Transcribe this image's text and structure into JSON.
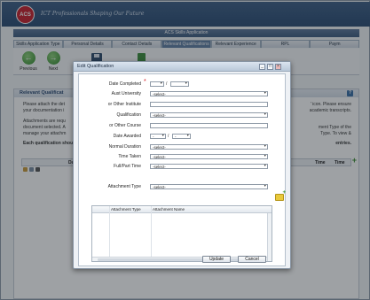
{
  "app": {
    "logo_text": "ACS",
    "tagline": "ICT Professionals Shaping Our Future",
    "window_title": "ACS Skills Application"
  },
  "tabs": [
    {
      "label": "Skills Application Type",
      "active": false
    },
    {
      "label": "Personal Details",
      "active": false
    },
    {
      "label": "Contact Details",
      "active": false
    },
    {
      "label": "Relevant Qualifications",
      "active": true
    },
    {
      "label": "Relevant Experience",
      "active": false
    },
    {
      "label": "RPL",
      "active": false
    },
    {
      "label": "Paym",
      "active": false
    }
  ],
  "toolbar": {
    "previous_label": "Previous",
    "next_label": "Next"
  },
  "section": {
    "title": "Relevant Qualificat",
    "line1": "Please attach the det",
    "line2": "your documentation i",
    "line3": "Attachments are requ",
    "line4": "document selected. A",
    "line5": "manage your attachm",
    "line6": "Each qualification shoul",
    "right1": "' icon. Please ensure",
    "right2": "academic transcripts.",
    "right3": "ment Type of the",
    "right4": "Type. To view &",
    "right5": "entries.",
    "grid_col_date": "Date C",
    "grid_col_time1": "Time",
    "grid_col_time2": "Time"
  },
  "dialog": {
    "title": "Edit Qualification",
    "fields": {
      "date_completed_label": "Date Completed",
      "date_completed_day": "",
      "date_completed_month": "",
      "aust_university_label": "Aust University",
      "aust_university_value": "-select-",
      "other_institute_label": "or Other Institute",
      "other_institute_value": "",
      "qualification_label": "Qualification",
      "qualification_value": "-select-",
      "other_course_label": "or Other Course",
      "other_course_value": "",
      "date_awarded_label": "Date Awarded",
      "date_awarded_day": "-",
      "date_awarded_month": "-",
      "normal_duration_label": "Normal Duration",
      "normal_duration_value": "-select-",
      "time_taken_label": "Time Taken",
      "time_taken_value": "-select-",
      "full_part_time_label": "Full/Part Time",
      "full_part_time_value": "-select-",
      "attachment_type_label": "Attachment Type",
      "attachment_type_value": "-select-"
    },
    "attachments_grid": {
      "col_type": "Attachment Type",
      "col_name": "Attachment Name"
    },
    "update_label": "Update",
    "cancel_label": "Cancel"
  }
}
